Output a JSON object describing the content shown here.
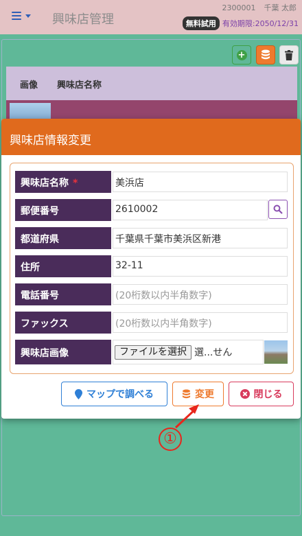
{
  "header": {
    "app_title": "興味店管理",
    "user_id": "2300001",
    "user_name": "千葉 太郎",
    "trial_badge": "無料試用",
    "expiry": "有効期限:2050/12/31"
  },
  "table": {
    "col_image": "画像",
    "col_name": "興味店名称"
  },
  "modal": {
    "title": "興味店情報変更",
    "fields": {
      "name": {
        "label": "興味店名称",
        "required_mark": "*",
        "value": "美浜店"
      },
      "postal": {
        "label": "郵便番号",
        "value": "2610002"
      },
      "prefecture": {
        "label": "都道府県",
        "value": "千葉県千葉市美浜区新港"
      },
      "address": {
        "label": "住所",
        "value": "32-11"
      },
      "phone": {
        "label": "電話番号",
        "placeholder": "(20桁数以内半角数字)"
      },
      "fax": {
        "label": "ファックス",
        "placeholder": "(20桁数以内半角数字)"
      },
      "image": {
        "label": "興味店画像",
        "file_button": "ファイルを選択",
        "file_status": "選...せん"
      }
    },
    "buttons": {
      "map": "マップで調べる",
      "change": "変更",
      "close": "閉じる"
    }
  },
  "annotation": {
    "number": "①"
  },
  "colors": {
    "header_bg": "#e4c3c5",
    "modal_header": "#e06a1d",
    "label_bg": "#4a2c5a",
    "background": "#5fb898"
  },
  "icons": [
    "menu-icon",
    "plus-circle-icon",
    "database-icon",
    "trash-icon",
    "search-icon",
    "map-marker-icon",
    "times-circle-icon"
  ]
}
